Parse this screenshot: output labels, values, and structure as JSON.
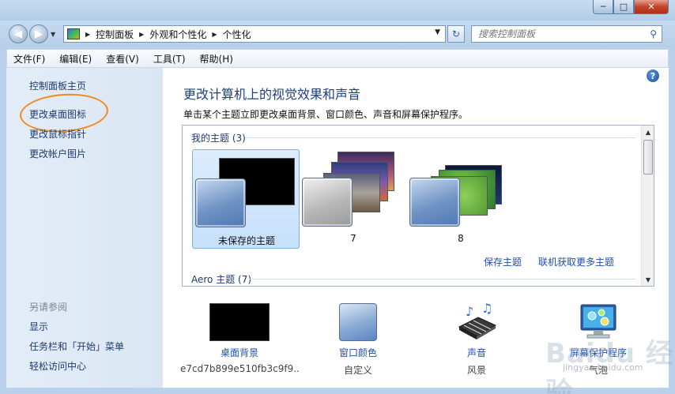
{
  "window": {
    "min_glyph": "─",
    "max_glyph": "□",
    "close_glyph": "✕"
  },
  "address": {
    "breadcrumb": [
      "控制面板",
      "外观和个性化",
      "个性化"
    ],
    "search_placeholder": "搜索控制面板"
  },
  "menu": [
    "文件(F)",
    "编辑(E)",
    "查看(V)",
    "工具(T)",
    "帮助(H)"
  ],
  "sidebar": {
    "home": "控制面板主页",
    "change_icons": "更改桌面图标",
    "change_pointer": "更改鼠标指针",
    "change_account_picture": "更改帐户图片",
    "see_also": "另请参阅",
    "display": "显示",
    "taskbar": "任务栏和「开始」菜单",
    "ease_of_access": "轻松访问中心"
  },
  "main": {
    "title": "更改计算机上的视觉效果和声音",
    "description": "单击某个主题立即更改桌面背景、窗口颜色、声音和屏幕保护程序。",
    "my_themes": "我的主题 (3)",
    "aero_themes": "Aero 主题 (7)",
    "themes": [
      {
        "name": "未保存的主题",
        "selected": true
      },
      {
        "name": "7",
        "selected": false
      },
      {
        "name": "8",
        "selected": false
      }
    ],
    "save_theme": "保存主题",
    "get_more_online": "联机获取更多主题"
  },
  "options": {
    "desktop_background": {
      "label": "桌面背景",
      "value": "e7cd7b899e510fb3c9f9..."
    },
    "window_color": {
      "label": "窗口颜色",
      "value": "自定义"
    },
    "sounds": {
      "label": "声音",
      "value": "风景"
    },
    "screen_saver": {
      "label": "屏幕保护程序",
      "value": "气泡"
    }
  },
  "watermark": {
    "brand": "Baidu 经验",
    "url": "jingyan.baidu.com"
  },
  "colors": {
    "accent_link": "#1f4fae",
    "title": "#1e3f83",
    "annotation": "#f28a1c"
  }
}
